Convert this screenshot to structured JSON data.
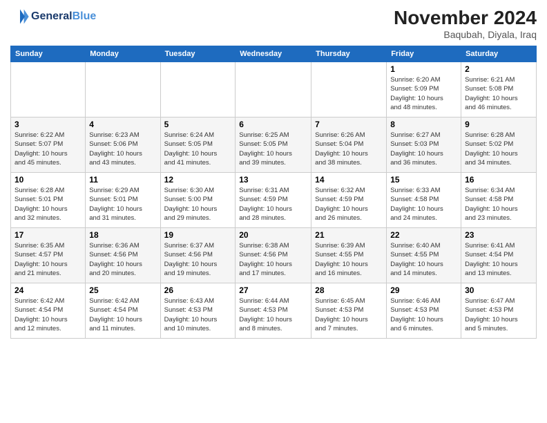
{
  "header": {
    "logo_line1": "General",
    "logo_line2": "Blue",
    "month": "November 2024",
    "location": "Baqubah, Diyala, Iraq"
  },
  "weekdays": [
    "Sunday",
    "Monday",
    "Tuesday",
    "Wednesday",
    "Thursday",
    "Friday",
    "Saturday"
  ],
  "weeks": [
    [
      {
        "day": "",
        "info": ""
      },
      {
        "day": "",
        "info": ""
      },
      {
        "day": "",
        "info": ""
      },
      {
        "day": "",
        "info": ""
      },
      {
        "day": "",
        "info": ""
      },
      {
        "day": "1",
        "info": "Sunrise: 6:20 AM\nSunset: 5:09 PM\nDaylight: 10 hours\nand 48 minutes."
      },
      {
        "day": "2",
        "info": "Sunrise: 6:21 AM\nSunset: 5:08 PM\nDaylight: 10 hours\nand 46 minutes."
      }
    ],
    [
      {
        "day": "3",
        "info": "Sunrise: 6:22 AM\nSunset: 5:07 PM\nDaylight: 10 hours\nand 45 minutes."
      },
      {
        "day": "4",
        "info": "Sunrise: 6:23 AM\nSunset: 5:06 PM\nDaylight: 10 hours\nand 43 minutes."
      },
      {
        "day": "5",
        "info": "Sunrise: 6:24 AM\nSunset: 5:05 PM\nDaylight: 10 hours\nand 41 minutes."
      },
      {
        "day": "6",
        "info": "Sunrise: 6:25 AM\nSunset: 5:05 PM\nDaylight: 10 hours\nand 39 minutes."
      },
      {
        "day": "7",
        "info": "Sunrise: 6:26 AM\nSunset: 5:04 PM\nDaylight: 10 hours\nand 38 minutes."
      },
      {
        "day": "8",
        "info": "Sunrise: 6:27 AM\nSunset: 5:03 PM\nDaylight: 10 hours\nand 36 minutes."
      },
      {
        "day": "9",
        "info": "Sunrise: 6:28 AM\nSunset: 5:02 PM\nDaylight: 10 hours\nand 34 minutes."
      }
    ],
    [
      {
        "day": "10",
        "info": "Sunrise: 6:28 AM\nSunset: 5:01 PM\nDaylight: 10 hours\nand 32 minutes."
      },
      {
        "day": "11",
        "info": "Sunrise: 6:29 AM\nSunset: 5:01 PM\nDaylight: 10 hours\nand 31 minutes."
      },
      {
        "day": "12",
        "info": "Sunrise: 6:30 AM\nSunset: 5:00 PM\nDaylight: 10 hours\nand 29 minutes."
      },
      {
        "day": "13",
        "info": "Sunrise: 6:31 AM\nSunset: 4:59 PM\nDaylight: 10 hours\nand 28 minutes."
      },
      {
        "day": "14",
        "info": "Sunrise: 6:32 AM\nSunset: 4:59 PM\nDaylight: 10 hours\nand 26 minutes."
      },
      {
        "day": "15",
        "info": "Sunrise: 6:33 AM\nSunset: 4:58 PM\nDaylight: 10 hours\nand 24 minutes."
      },
      {
        "day": "16",
        "info": "Sunrise: 6:34 AM\nSunset: 4:58 PM\nDaylight: 10 hours\nand 23 minutes."
      }
    ],
    [
      {
        "day": "17",
        "info": "Sunrise: 6:35 AM\nSunset: 4:57 PM\nDaylight: 10 hours\nand 21 minutes."
      },
      {
        "day": "18",
        "info": "Sunrise: 6:36 AM\nSunset: 4:56 PM\nDaylight: 10 hours\nand 20 minutes."
      },
      {
        "day": "19",
        "info": "Sunrise: 6:37 AM\nSunset: 4:56 PM\nDaylight: 10 hours\nand 19 minutes."
      },
      {
        "day": "20",
        "info": "Sunrise: 6:38 AM\nSunset: 4:56 PM\nDaylight: 10 hours\nand 17 minutes."
      },
      {
        "day": "21",
        "info": "Sunrise: 6:39 AM\nSunset: 4:55 PM\nDaylight: 10 hours\nand 16 minutes."
      },
      {
        "day": "22",
        "info": "Sunrise: 6:40 AM\nSunset: 4:55 PM\nDaylight: 10 hours\nand 14 minutes."
      },
      {
        "day": "23",
        "info": "Sunrise: 6:41 AM\nSunset: 4:54 PM\nDaylight: 10 hours\nand 13 minutes."
      }
    ],
    [
      {
        "day": "24",
        "info": "Sunrise: 6:42 AM\nSunset: 4:54 PM\nDaylight: 10 hours\nand 12 minutes."
      },
      {
        "day": "25",
        "info": "Sunrise: 6:42 AM\nSunset: 4:54 PM\nDaylight: 10 hours\nand 11 minutes."
      },
      {
        "day": "26",
        "info": "Sunrise: 6:43 AM\nSunset: 4:53 PM\nDaylight: 10 hours\nand 10 minutes."
      },
      {
        "day": "27",
        "info": "Sunrise: 6:44 AM\nSunset: 4:53 PM\nDaylight: 10 hours\nand 8 minutes."
      },
      {
        "day": "28",
        "info": "Sunrise: 6:45 AM\nSunset: 4:53 PM\nDaylight: 10 hours\nand 7 minutes."
      },
      {
        "day": "29",
        "info": "Sunrise: 6:46 AM\nSunset: 4:53 PM\nDaylight: 10 hours\nand 6 minutes."
      },
      {
        "day": "30",
        "info": "Sunrise: 6:47 AM\nSunset: 4:53 PM\nDaylight: 10 hours\nand 5 minutes."
      }
    ]
  ]
}
